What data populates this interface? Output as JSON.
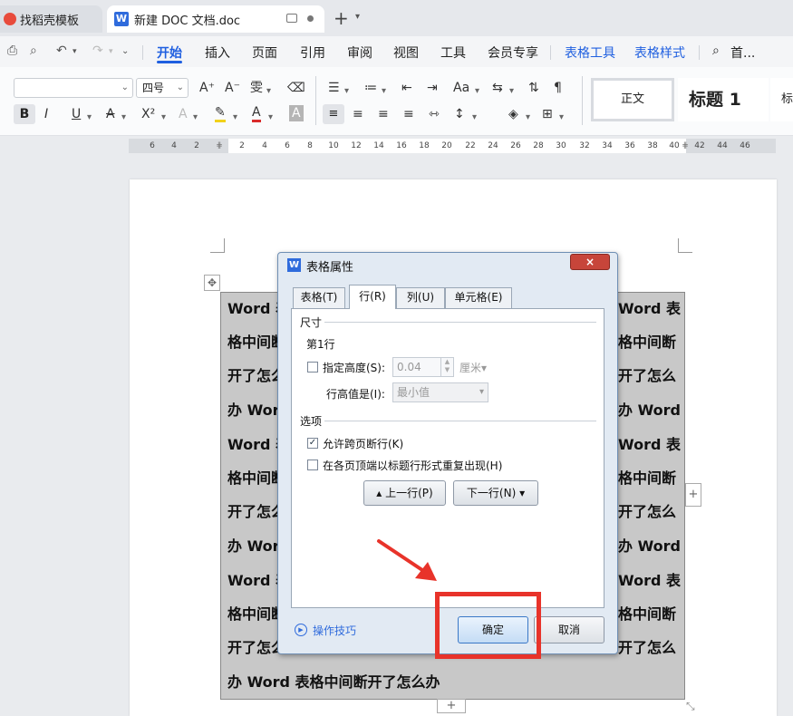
{
  "tabs": {
    "templates_label": "找稻壳模板",
    "doc_label": "新建 DOC 文档.doc",
    "doc_logo": "W",
    "new_tab": "+"
  },
  "menu": {
    "items": [
      "开始",
      "插入",
      "页面",
      "引用",
      "审阅",
      "视图",
      "工具",
      "会员专享",
      "表格工具",
      "表格样式"
    ],
    "search_label": "首..."
  },
  "ribbon": {
    "font_name": "",
    "font_size": "四号",
    "style_normal": "正文",
    "style_heading1": "标题  1",
    "style_more": "标"
  },
  "ruler": {
    "ticks": [
      "6",
      "4",
      "2",
      "2",
      "4",
      "6",
      "8",
      "10",
      "12",
      "14",
      "16",
      "18",
      "20",
      "22",
      "24",
      "26",
      "28",
      "30",
      "32",
      "34",
      "36",
      "38",
      "40",
      "42",
      "44",
      "46"
    ]
  },
  "document": {
    "left_col": [
      "Word 表",
      "格中间断",
      "开了怎么",
      "办 Word",
      "Word 表",
      "格中间断",
      "开了怎么",
      "办 Word",
      "Word 表",
      "格中间断",
      "开了怎么"
    ],
    "right_col": [
      "Word 表",
      "格中间断",
      "开了怎么",
      "办 Word",
      "Word 表",
      "格中间断",
      "开了怎么",
      "办 Word",
      "Word 表",
      "格中间断",
      "开了怎么"
    ],
    "last_line": "办 Word 表格中间断开了怎么办"
  },
  "dialog": {
    "icon": "W",
    "title": "表格属性",
    "close": "×",
    "tabs": [
      "表格(T)",
      "行(R)",
      "列(U)",
      "单元格(E)"
    ],
    "active_tab": "行(R)",
    "section_size": "尺寸",
    "row_label": "第1行",
    "specify_height_label": "指定高度(S):",
    "height_value": "0.04",
    "height_unit": "厘米▾",
    "row_height_is_label": "行高值是(I):",
    "row_height_mode": "最小值",
    "section_options": "选项",
    "allow_break_label": "允许跨页断行(K)",
    "allow_break_checked": true,
    "repeat_header_label": "在各页顶端以标题行形式重复出现(H)",
    "repeat_header_checked": false,
    "prev_row_button": "上一行(P)",
    "next_row_button": "下一行(N)",
    "tips_link": "操作技巧",
    "ok_button": "确定",
    "cancel_button": "取消"
  },
  "colors": {
    "accent": "#1f5fe0",
    "highlight": "#e8332a",
    "table_shading": "#c8c8c8"
  }
}
